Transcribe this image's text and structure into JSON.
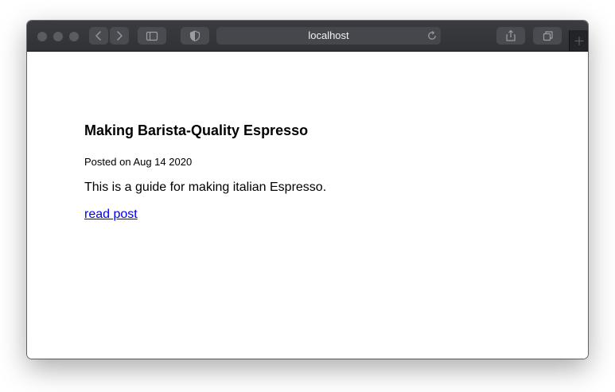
{
  "browser": {
    "address_text": "localhost",
    "icons": {
      "back": "chevron-left-icon",
      "forward": "chevron-right-icon",
      "sidebar": "sidebar-icon",
      "privacy": "shield-icon",
      "reload": "reload-icon",
      "share": "share-icon",
      "tabs": "tabs-icon",
      "new_tab": "plus-icon"
    }
  },
  "post": {
    "title": "Making Barista-Quality Espresso",
    "date": "Posted on Aug 14 2020",
    "excerpt": "This is a guide for making italian Espresso.",
    "link_label": "read post"
  },
  "colors": {
    "toolbar": "#3b3c40",
    "link": "#0000ee",
    "text": "#000000"
  }
}
